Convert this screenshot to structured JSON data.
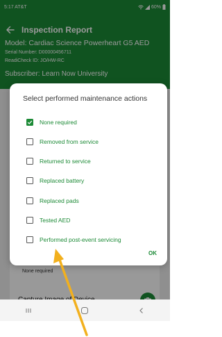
{
  "status": {
    "time_carrier": "5:17 AT&T",
    "battery": "60%"
  },
  "header": {
    "title": "Inspection Report",
    "model": "Model: Cardiac Science Powerheart G5 AED",
    "serial": "Serial Number: D00000456711",
    "readicheck": "ReadiCheck ID: JO/HW-RC",
    "subscriber": "Subscriber: Learn Now University"
  },
  "dialog": {
    "title": "Select performed maintenance actions",
    "options": [
      {
        "label": "None required",
        "checked": true
      },
      {
        "label": "Removed from service",
        "checked": false
      },
      {
        "label": "Returned to service",
        "checked": false
      },
      {
        "label": "Replaced battery",
        "checked": false
      },
      {
        "label": "Replaced pads",
        "checked": false
      },
      {
        "label": "Tested AED",
        "checked": false
      },
      {
        "label": "Performed post-event servicing",
        "checked": false
      }
    ],
    "ok_label": "OK"
  },
  "form": {
    "maintenance_value": "None required",
    "capture_label": "Capture Image of Device"
  },
  "colors": {
    "brand_green": "#1c8a36",
    "annotation_arrow": "#f2b01e"
  },
  "icons": {
    "back": "arrow-left-icon",
    "camera": "camera-icon",
    "nav": [
      "recent-apps-icon",
      "home-icon",
      "back-nav-icon"
    ]
  }
}
